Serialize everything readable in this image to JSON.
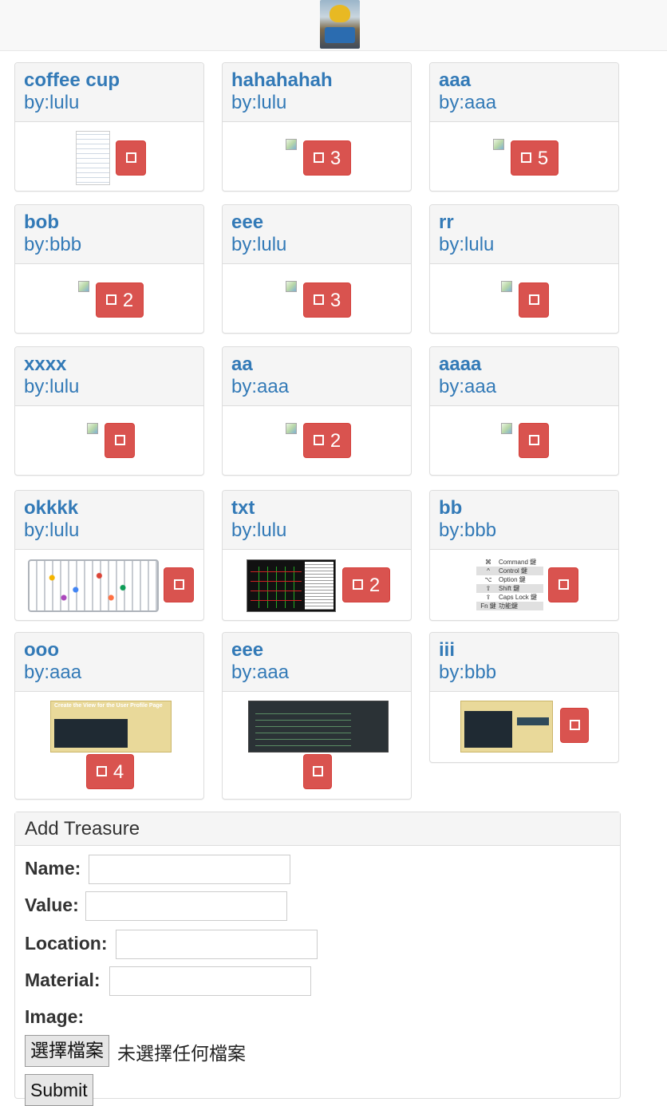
{
  "treasures": [
    {
      "title": "coffee cup",
      "by": "by:lulu",
      "count": ""
    },
    {
      "title": "hahahahah",
      "by": "by:lulu",
      "count": "3"
    },
    {
      "title": "aaa",
      "by": "by:aaa",
      "count": "5"
    },
    {
      "title": "bob",
      "by": "by:bbb",
      "count": "2"
    },
    {
      "title": "eee",
      "by": "by:lulu",
      "count": "3"
    },
    {
      "title": "rr",
      "by": "by:lulu",
      "count": ""
    },
    {
      "title": "xxxx",
      "by": "by:lulu",
      "count": ""
    },
    {
      "title": "aa",
      "by": "by:aaa",
      "count": "2"
    },
    {
      "title": "aaaa",
      "by": "by:aaa",
      "count": ""
    },
    {
      "title": "okkkk",
      "by": "by:lulu",
      "count": ""
    },
    {
      "title": "txt",
      "by": "by:lulu",
      "count": "2"
    },
    {
      "title": "bb",
      "by": "by:bbb",
      "count": ""
    },
    {
      "title": "ooo",
      "by": "by:aaa",
      "count": "4"
    },
    {
      "title": "eee",
      "by": "by:aaa",
      "count": ""
    },
    {
      "title": "iii",
      "by": "by:bbb",
      "count": ""
    }
  ],
  "keys_image": [
    {
      "sym": "⌘",
      "label": "Command 鍵"
    },
    {
      "sym": "^",
      "label": "Control 鍵"
    },
    {
      "sym": "⌥",
      "label": "Option 鍵"
    },
    {
      "sym": "⇧",
      "label": "Shift 鍵"
    },
    {
      "sym": "⇪",
      "label": "Caps Lock 鍵"
    },
    {
      "sym": "Fn 鍵",
      "label": "功能鍵"
    }
  ],
  "image_texts": {
    "profile": "Create the View for the User Profile Page"
  },
  "form": {
    "heading": "Add Treasure",
    "name_label": "Name:",
    "value_label": "Value:",
    "location_label": "Location:",
    "material_label": "Material:",
    "image_label": "Image:",
    "file_button": "選擇檔案",
    "file_status": "未選擇任何檔案",
    "submit": "Submit"
  },
  "colors": {
    "link": "#337ab7",
    "danger": "#d9534f"
  }
}
